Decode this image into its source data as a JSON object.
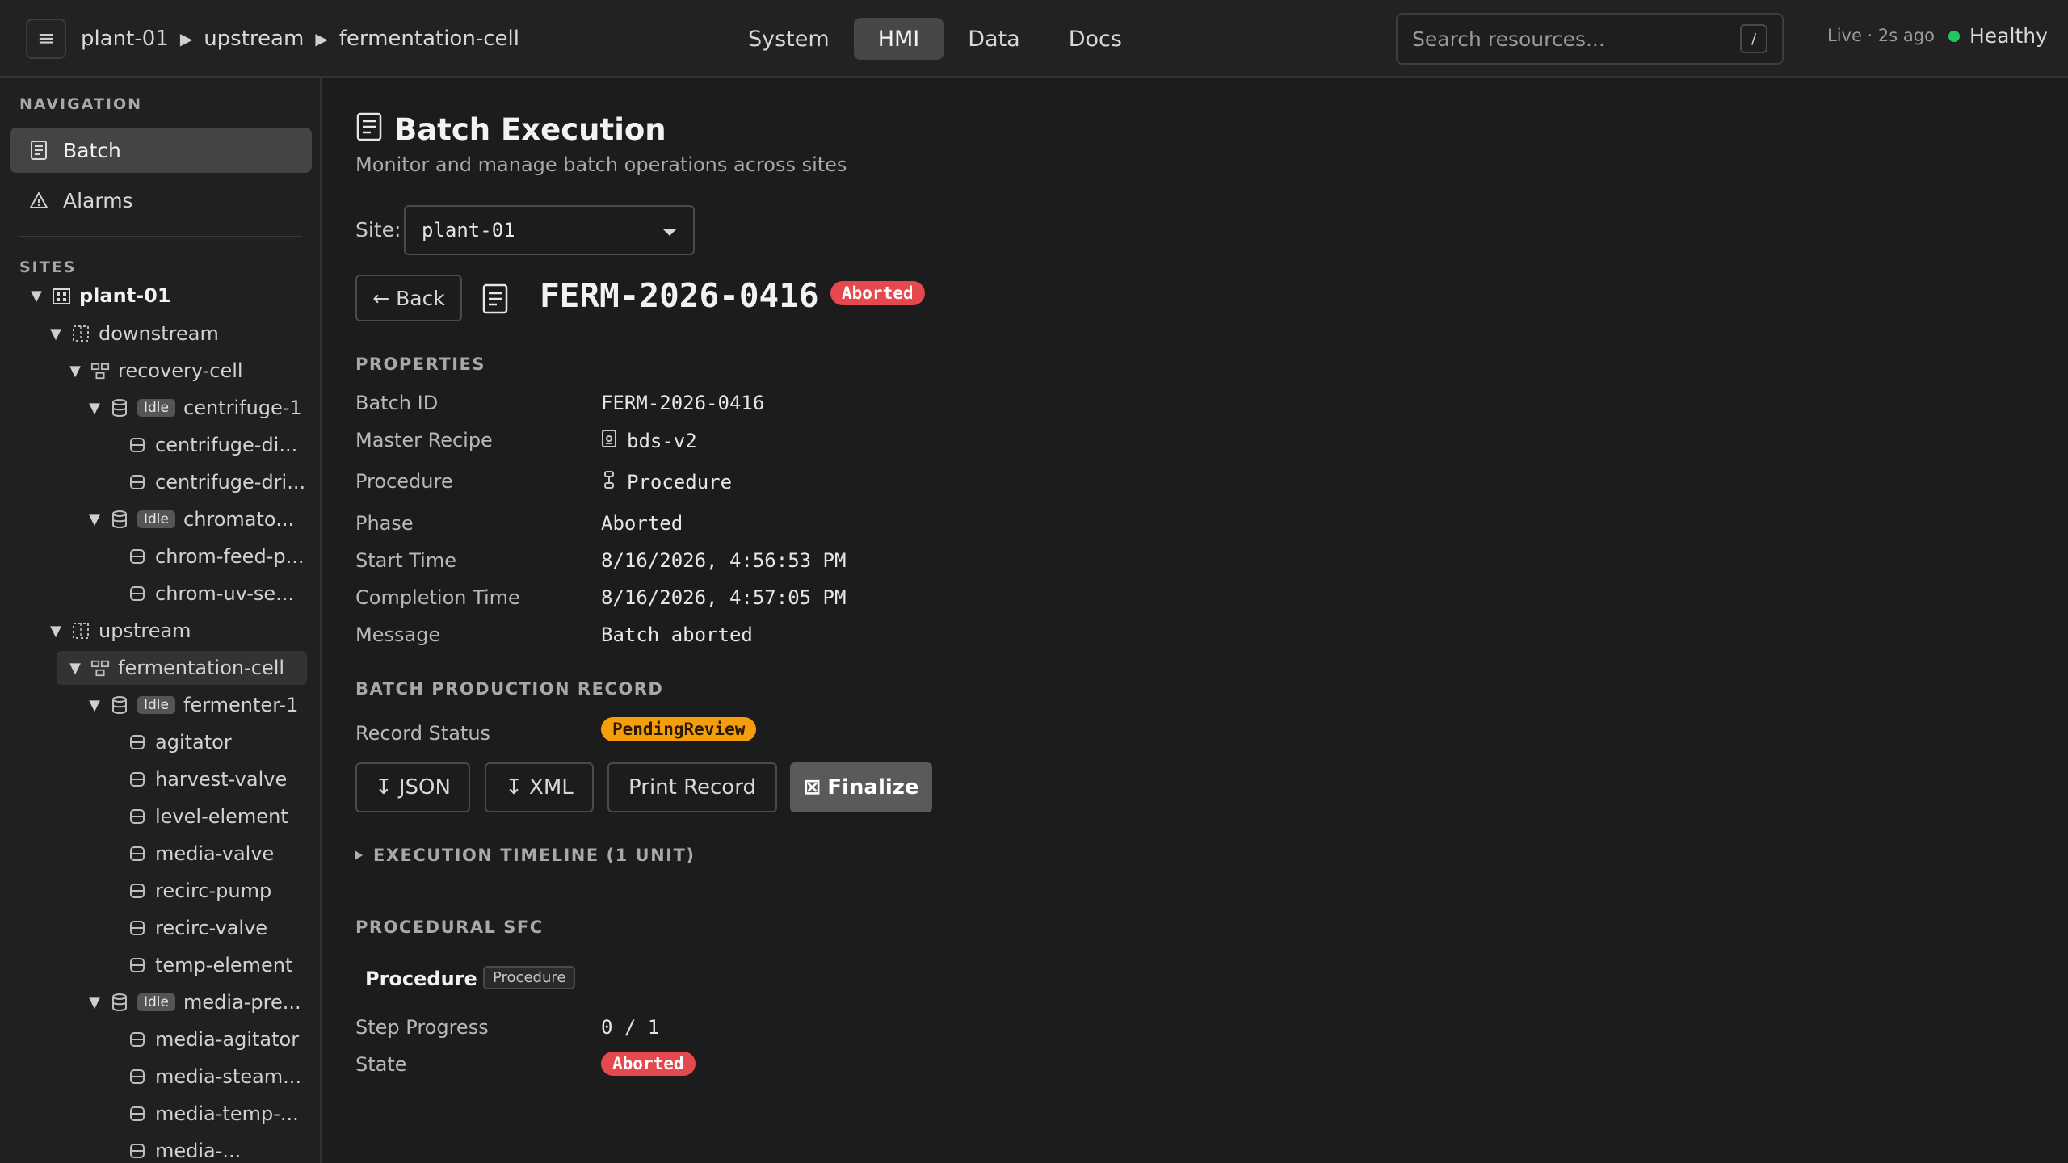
{
  "topbar": {
    "menu_icon": "hamburger-icon",
    "breadcrumb": [
      "plant-01",
      "upstream",
      "fermentation-cell"
    ],
    "breadcrumb_separator": "▶",
    "tabs": [
      {
        "label": "System",
        "active": false
      },
      {
        "label": "HMI",
        "active": true
      },
      {
        "label": "Data",
        "active": false
      },
      {
        "label": "Docs",
        "active": false
      }
    ],
    "search": {
      "placeholder": "Search resources...",
      "shortcut": "/"
    },
    "live_status": "Live · 2s ago",
    "health": {
      "label": "Healthy",
      "color": "#22c55e"
    }
  },
  "sidebar": {
    "nav_heading": "NAVIGATION",
    "nav_items": [
      {
        "label": "Batch",
        "icon": "document-icon",
        "active": true
      },
      {
        "label": "Alarms",
        "icon": "warning-icon",
        "active": false
      }
    ],
    "sites_heading": "SITES",
    "tree": [
      {
        "label": "plant-01",
        "kind": "site",
        "expanded": true
      },
      {
        "label": "downstream",
        "kind": "area",
        "expanded": true
      },
      {
        "label": "recovery-cell",
        "kind": "cell",
        "expanded": true
      },
      {
        "label": "centrifuge-1",
        "kind": "unit",
        "badge": "Idle",
        "expanded": true
      },
      {
        "label": "centrifuge-di...",
        "kind": "module"
      },
      {
        "label": "centrifuge-dri...",
        "kind": "module"
      },
      {
        "label": "chromato...",
        "kind": "unit",
        "badge": "Idle",
        "expanded": true
      },
      {
        "label": "chrom-feed-p...",
        "kind": "module"
      },
      {
        "label": "chrom-uv-se...",
        "kind": "module"
      },
      {
        "label": "upstream",
        "kind": "area",
        "expanded": true
      },
      {
        "label": "fermentation-cell",
        "kind": "cell",
        "expanded": true,
        "selected": true
      },
      {
        "label": "fermenter-1",
        "kind": "unit",
        "badge": "Idle",
        "expanded": true
      },
      {
        "label": "agitator",
        "kind": "module"
      },
      {
        "label": "harvest-valve",
        "kind": "module"
      },
      {
        "label": "level-element",
        "kind": "module"
      },
      {
        "label": "media-valve",
        "kind": "module"
      },
      {
        "label": "recirc-pump",
        "kind": "module"
      },
      {
        "label": "recirc-valve",
        "kind": "module"
      },
      {
        "label": "temp-element",
        "kind": "module"
      },
      {
        "label": "media-pre...",
        "kind": "unit",
        "badge": "Idle",
        "expanded": true
      },
      {
        "label": "media-agitator",
        "kind": "module"
      },
      {
        "label": "media-steam...",
        "kind": "module"
      },
      {
        "label": "media-temp-...",
        "kind": "module"
      },
      {
        "label": "media-...",
        "kind": "module"
      }
    ]
  },
  "main": {
    "title": "Batch Execution",
    "subtitle": "Monitor and manage batch operations across sites",
    "site_label": "Site:",
    "site_value": "plant-01",
    "back_label": "← Back",
    "batch_id": "FERM-2026-0416",
    "batch_status": "Aborted",
    "properties_heading": "PROPERTIES",
    "properties": [
      {
        "label": "Batch ID",
        "value": "FERM-2026-0416"
      },
      {
        "label": "Master Recipe",
        "value": "bds-v2",
        "icon": "recipe-icon"
      },
      {
        "label": "Procedure",
        "value": "Procedure",
        "icon": "procedure-icon"
      },
      {
        "label": "Phase",
        "value": "Aborted"
      },
      {
        "label": "Start Time",
        "value": "8/16/2026, 4:56:53 PM"
      },
      {
        "label": "Completion Time",
        "value": "8/16/2026, 4:57:05 PM"
      },
      {
        "label": "Message",
        "value": "Batch aborted"
      }
    ],
    "bpr_heading": "BATCH PRODUCTION RECORD",
    "record_status_label": "Record Status",
    "record_status": "PendingReview",
    "actions": {
      "json": "JSON",
      "xml": "XML",
      "print": "Print Record",
      "finalize": "Finalize",
      "download_glyph": "↧",
      "finalize_glyph": "⊠"
    },
    "timeline_heading": "EXECUTION TIMELINE (1 UNIT)",
    "sfc_heading": "PROCEDURAL SFC",
    "sfc": {
      "name": "Procedure",
      "tag": "Procedure",
      "step_progress_label": "Step Progress",
      "step_progress": "0 / 1",
      "state_label": "State",
      "state": "Aborted"
    }
  },
  "colors": {
    "aborted": "#e5484d",
    "pending": "#f59e0b",
    "healthy": "#22c55e"
  }
}
